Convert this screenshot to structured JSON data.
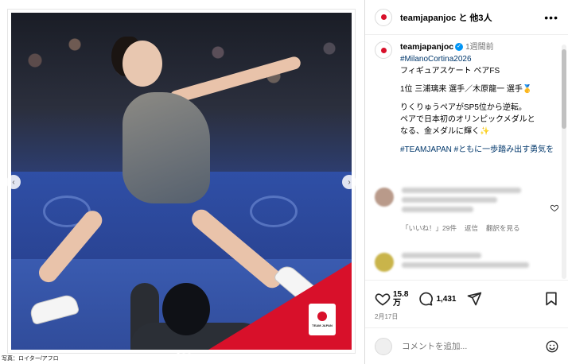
{
  "header": {
    "title": "teamjapanjoc と 他3人",
    "more_icon": "more-horizontal-icon"
  },
  "post": {
    "username": "teamjapanjoc",
    "time": "1週間前",
    "caption_lines": [
      "#MilanoCortina2026",
      "フィギュアスケート ペアFS",
      "",
      "1位 三浦璃来 選手／木原龍一 選手🥇",
      "",
      "りくりゅうペアがSP5位から逆転。",
      "ペアで日本初のオリンピックメダルと",
      "なる、金メダルに輝く✨",
      "",
      "#TEAMJAPAN",
      "#ともに一歩踏み出す勇気を"
    ]
  },
  "comments": [
    {
      "likes": "「いいね！」29件",
      "reply": "返信",
      "translate": "翻訳を見る"
    }
  ],
  "actions": {
    "likes_count": "15.8\n万",
    "likes_main": "15.8",
    "likes_unit": "万",
    "comments_count": "1,431",
    "date": "2月17日"
  },
  "add_comment": {
    "placeholder": "コメントを追加..."
  },
  "image": {
    "credit": "写真：ロイター/アフロ",
    "emblem_text": "TEAM JAPAN"
  },
  "colors": {
    "accent_red": "#d8102a",
    "link_blue": "#00376b",
    "verified_blue": "#0095f6"
  }
}
